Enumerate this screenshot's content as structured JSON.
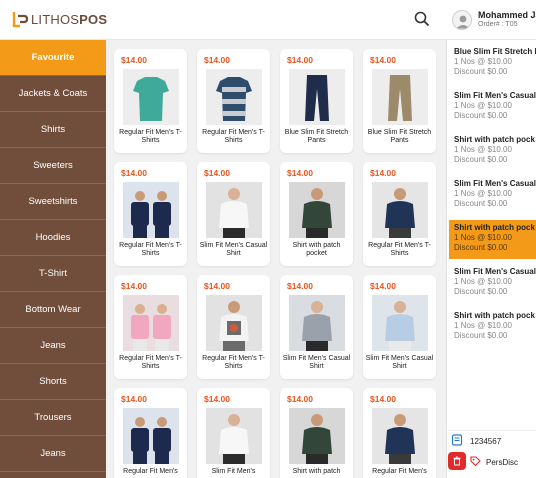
{
  "brand": {
    "logo_regular": "LITHOS",
    "logo_bold": "POS"
  },
  "user": {
    "name": "Mohammed Jaf",
    "order": "Order# : T05"
  },
  "categories": [
    {
      "label": "Favourite",
      "active": true
    },
    {
      "label": "Jackets & Coats"
    },
    {
      "label": "Shirts"
    },
    {
      "label": "Sweeters"
    },
    {
      "label": "Sweetshirts"
    },
    {
      "label": "Hoodies"
    },
    {
      "label": "T-Shirt"
    },
    {
      "label": "Bottom Wear"
    },
    {
      "label": "Jeans"
    },
    {
      "label": "Shorts"
    },
    {
      "label": "Trousers"
    },
    {
      "label": "Jeans"
    }
  ],
  "products": [
    {
      "price": "$14.00",
      "name": "Regular Fit Men's T-Shirts",
      "image": "teal-tshirt"
    },
    {
      "price": "$14.00",
      "name": "Regular Fit Men's T-Shirts",
      "image": "striped-tshirt"
    },
    {
      "price": "$14.00",
      "name": "Blue Slim Fit Stretch Pants",
      "image": "navy-pants"
    },
    {
      "price": "$14.00",
      "name": "Blue Slim Fit Stretch Pants",
      "image": "khaki-pants"
    },
    {
      "price": "$14.00",
      "name": "Regular Fit Men's T-Shirts",
      "image": "two-models-navy-tees"
    },
    {
      "price": "$14.00",
      "name": "Slim Fit Men's Casual Shirt",
      "image": "white-shirt-model"
    },
    {
      "price": "$14.00",
      "name": "Shirt with patch pocket",
      "image": "green-check-shirt-model"
    },
    {
      "price": "$14.00",
      "name": "Regular Fit Men's T-Shirts",
      "image": "navy-polo-model"
    },
    {
      "price": "$14.00",
      "name": "Regular Fit Men's T-Shirts",
      "image": "pink-tees-models"
    },
    {
      "price": "$14.00",
      "name": "Regular Fit Men's T-Shirts",
      "image": "graphic-tee-back"
    },
    {
      "price": "$14.00",
      "name": "Slim Fit Men's Casual Shirt",
      "image": "grey-jacket-model"
    },
    {
      "price": "$14.00",
      "name": "Slim Fit Men's Casual Shirt",
      "image": "blue-jacket-model"
    },
    {
      "price": "$14.00",
      "name": "Regular Fit Men's",
      "image": "two-models-navy-tees"
    },
    {
      "price": "$14.00",
      "name": "Slim Fit Men's",
      "image": "white-shirt-model"
    },
    {
      "price": "$14.00",
      "name": "Shirt with patch",
      "image": "green-check-shirt-model"
    },
    {
      "price": "$14.00",
      "name": "Regular Fit Men's",
      "image": "navy-polo-model"
    }
  ],
  "cart": [
    {
      "name": "Blue Slim Fit Stretch P",
      "qty": "1 Nos @ $10.00",
      "discount": "Discount $0.00",
      "selected": false
    },
    {
      "name": "Slim Fit Men's Casual",
      "qty": "1 Nos @ $10.00",
      "discount": "Discount $0.00",
      "selected": false
    },
    {
      "name": "Shirt with patch pock",
      "qty": "1 Nos @ $10.00",
      "discount": "Discount $0.00",
      "selected": false
    },
    {
      "name": "Slim Fit Men's Casual",
      "qty": "1 Nos @ $10.00",
      "discount": "Discount $0.00",
      "selected": false
    },
    {
      "name": "Shirt with patch pock",
      "qty": "1 Nos @ $10.00",
      "discount": "Discount $0.00",
      "selected": true
    },
    {
      "name": "Slim Fit Men's Casual",
      "qty": "1 Nos @ $10.00",
      "discount": "Discount $0.00",
      "selected": false
    },
    {
      "name": "Shirt with patch pock",
      "qty": "1 Nos @ $10.00",
      "discount": "Discount $0.00",
      "selected": false
    }
  ],
  "footer": {
    "barcode_value": "1234567",
    "discount_label": "PersDisc"
  },
  "colors": {
    "accent": "#f39a18",
    "sidebar": "#704e3b",
    "price": "#e8551e",
    "delete": "#e12a2a"
  },
  "icons": {
    "search": "search-icon",
    "user": "user-icon",
    "barcode": "barcode-icon",
    "tag": "tag-icon",
    "delete": "trash-icon"
  }
}
